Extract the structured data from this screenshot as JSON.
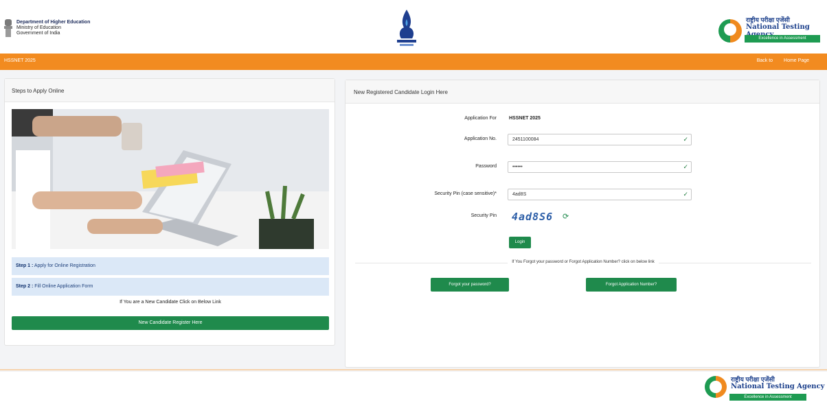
{
  "header": {
    "ministry_line1": "Department of Higher Education",
    "ministry_line2": "Ministry of Education",
    "ministry_line3": "Government of India",
    "nta_hindi": "राष्ट्रीय परीक्षा एजेंसी",
    "nta_english": "National Testing Agency",
    "nta_tagline": "Excellence in Assessment"
  },
  "nav": {
    "title": "HSSNET 2025",
    "links": [
      "Back to",
      "Home Page"
    ]
  },
  "left": {
    "panel_title": "Steps to Apply Online",
    "steps": [
      {
        "bold": "Step 1 :",
        "text": " Apply for Online Registration"
      },
      {
        "bold": "Step 2 :",
        "text": " Fill Online Application Form"
      }
    ],
    "new_candidate_text": "If You are a New Candidate Click on Below Link",
    "new_candidate_button": "New Candidate Register Here"
  },
  "right": {
    "panel_title": "New Registered Candidate Login Here",
    "application_for_label": "Application For",
    "application_for_value": "HSSNET 2025",
    "application_no_label": "Application No.",
    "application_no_value": "2451100084",
    "password_label": "Password",
    "password_value": "••••••",
    "security_pin_input_label": "Security Pin (case sensitive)*",
    "security_pin_input_value": "4ad8S",
    "security_pin_label": "Security Pin",
    "captcha_text": "4ad8S6",
    "login_button": "Login",
    "forgot_text": "If You Forgot your password or Forgot Application Number? click on below link",
    "forgot_password_button": "Forgot your password?",
    "forgot_appno_button": "Forgot Application Number?"
  },
  "footer": {
    "nta_hindi": "राष्ट्रीय परीक्षा एजेंसी",
    "nta_english": "National Testing Agency",
    "nta_tagline": "Excellence in Assessment"
  }
}
